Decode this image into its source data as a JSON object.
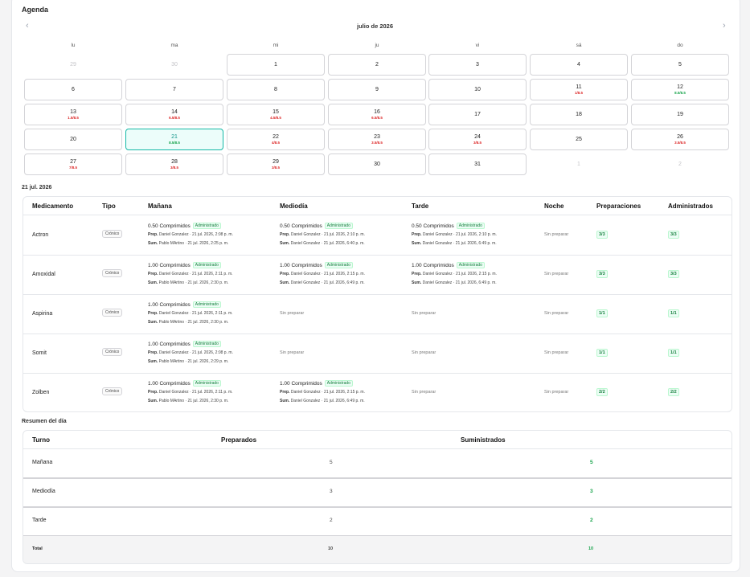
{
  "agenda": {
    "title": "Agenda",
    "month": "julio de 2026",
    "prev_icon": "‹",
    "next_icon": "›",
    "weekdays": [
      "lu",
      "ma",
      "mi",
      "ju",
      "vi",
      "sá",
      "do"
    ],
    "days": [
      {
        "n": "29",
        "s": "",
        "t": "outside"
      },
      {
        "n": "30",
        "s": "",
        "t": "outside"
      },
      {
        "n": "1",
        "s": ""
      },
      {
        "n": "2",
        "s": ""
      },
      {
        "n": "3",
        "s": ""
      },
      {
        "n": "4",
        "s": ""
      },
      {
        "n": "5",
        "s": ""
      },
      {
        "n": "6",
        "s": ""
      },
      {
        "n": "7",
        "s": ""
      },
      {
        "n": "8",
        "s": ""
      },
      {
        "n": "9",
        "s": ""
      },
      {
        "n": "10",
        "s": ""
      },
      {
        "n": "11",
        "s": "1/8.5",
        "c": "red"
      },
      {
        "n": "12",
        "s": "8.5/8.5",
        "c": "green"
      },
      {
        "n": "13",
        "s": "1.5/8.5",
        "c": "red"
      },
      {
        "n": "14",
        "s": "6.5/8.5",
        "c": "red"
      },
      {
        "n": "15",
        "s": "4.5/8.5",
        "c": "red"
      },
      {
        "n": "16",
        "s": "6.5/8.5",
        "c": "red"
      },
      {
        "n": "17",
        "s": ""
      },
      {
        "n": "18",
        "s": ""
      },
      {
        "n": "19",
        "s": ""
      },
      {
        "n": "20",
        "s": ""
      },
      {
        "n": "21",
        "s": "8.5/8.5",
        "c": "green",
        "t": "selected"
      },
      {
        "n": "22",
        "s": "4/8.5",
        "c": "red"
      },
      {
        "n": "23",
        "s": "3.5/8.5",
        "c": "red"
      },
      {
        "n": "24",
        "s": "3/8.5",
        "c": "red"
      },
      {
        "n": "25",
        "s": ""
      },
      {
        "n": "26",
        "s": "3.5/8.5",
        "c": "red"
      },
      {
        "n": "27",
        "s": "7/8.5",
        "c": "red"
      },
      {
        "n": "28",
        "s": "3/8.5",
        "c": "red"
      },
      {
        "n": "29",
        "s": "3/8.5",
        "c": "red"
      },
      {
        "n": "30",
        "s": ""
      },
      {
        "n": "31",
        "s": ""
      },
      {
        "n": "1",
        "s": "",
        "t": "outside"
      },
      {
        "n": "2",
        "s": "",
        "t": "outside"
      }
    ]
  },
  "selected_date": "21 jul. 2026",
  "med_table": {
    "headers": [
      "Medicamento",
      "Tipo",
      "Mañana",
      "Mediodía",
      "Tarde",
      "Noche",
      "Preparaciones",
      "Administrados"
    ],
    "badge_text": "Administrado",
    "not_prepared": "Sin preparar",
    "rows": [
      {
        "name": "Actron",
        "tipo": "Crónico",
        "slots": [
          {
            "dose": "0.50 Comprimidos",
            "prep": "Daniel Gonzalez · 21 jul. 2026, 2:08 p. m.",
            "sum": "Pablo MArtino · 21 jul. 2026, 2:25 p. m."
          },
          {
            "dose": "0.50 Comprimidos",
            "prep": "Daniel Gonzalez · 21 jul. 2026, 2:10 p. m.",
            "sum": "Daniel Gonzalez · 21 jul. 2026, 6:40 p. m."
          },
          {
            "dose": "0.50 Comprimidos",
            "prep": "Daniel Gonzalez · 21 jul. 2026, 2:10 p. m.",
            "sum": "Daniel Gonzalez · 21 jul. 2026, 6:49 p. m."
          },
          null
        ],
        "preps": "3/3",
        "admin": "3/3"
      },
      {
        "name": "Amoxidal",
        "tipo": "Crónico",
        "slots": [
          {
            "dose": "1.00 Comprimidos",
            "prep": "Daniel Gonzalez · 21 jul. 2026, 2:11 p. m.",
            "sum": "Pablo MArtino · 21 jul. 2026, 2:30 p. m."
          },
          {
            "dose": "1.00 Comprimidos",
            "prep": "Daniel Gonzalez · 21 jul. 2026, 2:15 p. m.",
            "sum": "Daniel Gonzalez · 21 jul. 2026, 6:49 p. m."
          },
          {
            "dose": "1.00 Comprimidos",
            "prep": "Daniel Gonzalez · 21 jul. 2026, 2:15 p. m.",
            "sum": "Daniel Gonzalez · 21 jul. 2026, 6:49 p. m."
          },
          null
        ],
        "preps": "3/3",
        "admin": "3/3"
      },
      {
        "name": "Aspirina",
        "tipo": "Crónico",
        "slots": [
          {
            "dose": "1.00 Comprimidos",
            "prep": "Daniel Gonzalez · 21 jul. 2026, 2:11 p. m.",
            "sum": "Pablo MArtino · 21 jul. 2026, 2:30 p. m."
          },
          null,
          null,
          null
        ],
        "preps": "1/1",
        "admin": "1/1"
      },
      {
        "name": "Somit",
        "tipo": "Crónico",
        "slots": [
          {
            "dose": "1.00 Comprimidos",
            "prep": "Daniel Gonzalez · 21 jul. 2026, 2:08 p. m.",
            "sum": "Pablo MArtino · 21 jul. 2026, 2:29 p. m."
          },
          null,
          null,
          null
        ],
        "preps": "1/1",
        "admin": "1/1"
      },
      {
        "name": "Zolben",
        "tipo": "Crónico",
        "slots": [
          {
            "dose": "1.00 Comprimidos",
            "prep": "Daniel Gonzalez · 21 jul. 2026, 2:11 p. m.",
            "sum": "Pablo MArtino · 21 jul. 2026, 2:30 p. m."
          },
          {
            "dose": "1.00 Comprimidos",
            "prep": "Daniel Gonzalez · 21 jul. 2026, 2:15 p. m.",
            "sum": "Daniel Gonzalez · 21 jul. 2026, 6:49 p. m."
          },
          null,
          null
        ],
        "preps": "2/2",
        "admin": "2/2"
      }
    ],
    "prep_prefix": "Prep.",
    "sum_prefix": "Sum."
  },
  "summary": {
    "title": "Resumen del día",
    "headers": [
      "Turno",
      "Preparados",
      "Suministrados"
    ],
    "rows": [
      {
        "turno": "Mañana",
        "prep": "5",
        "sum": "5"
      },
      {
        "turno": "Mediodía",
        "prep": "3",
        "sum": "3"
      },
      {
        "turno": "Tarde",
        "prep": "2",
        "sum": "2"
      }
    ],
    "total": {
      "label": "Total",
      "prep": "10",
      "sum": "10"
    }
  },
  "colors": {
    "accent": "#14b8a6",
    "ok": "#16a34a",
    "bad": "#dc2626"
  }
}
